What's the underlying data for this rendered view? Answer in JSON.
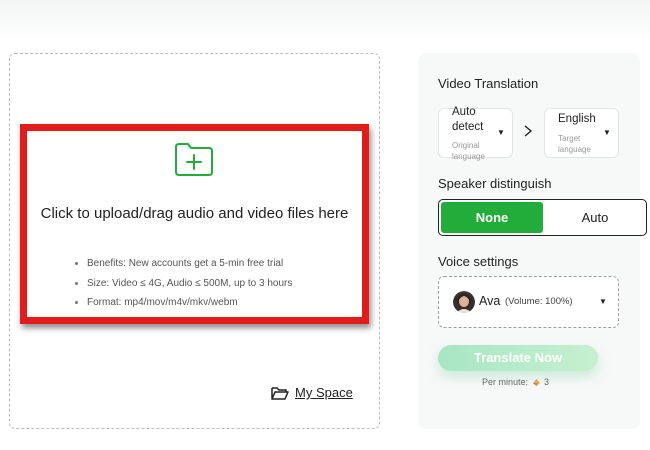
{
  "upload": {
    "title": "Click to upload/drag audio and video files here",
    "benefits": [
      "Benefits: New accounts get a 5-min free trial",
      "Size: Video ≤ 4G, Audio ≤ 500M, up to 3 hours",
      "Format: mp4/mov/m4v/mkv/webm"
    ],
    "my_space_label": "My Space"
  },
  "panel": {
    "video_translation_label": "Video Translation",
    "source_lang": {
      "line1": "Auto",
      "line2": "detect",
      "sub1": "Original",
      "sub2": "language"
    },
    "target_lang": {
      "value": "English",
      "sub1": "Target",
      "sub2": "language"
    },
    "speaker_label": "Speaker distinguish",
    "speaker_options": {
      "none": "None",
      "auto": "Auto",
      "selected": "None"
    },
    "voice_label": "Voice settings",
    "voice": {
      "name": "Ava",
      "volume": "(Volume: 100%)"
    },
    "translate_button": "Translate Now",
    "per_minute_label": "Per minute:",
    "per_minute_cost": "3"
  },
  "colors": {
    "accent_green": "#22ad3a",
    "highlight_red": "#e31b1b",
    "button_green_light": "#a8e6c4"
  },
  "icons": [
    "folder-plus-icon",
    "folder-open-icon",
    "arrow-right-icon",
    "caret-down-icon",
    "coin-icon"
  ]
}
